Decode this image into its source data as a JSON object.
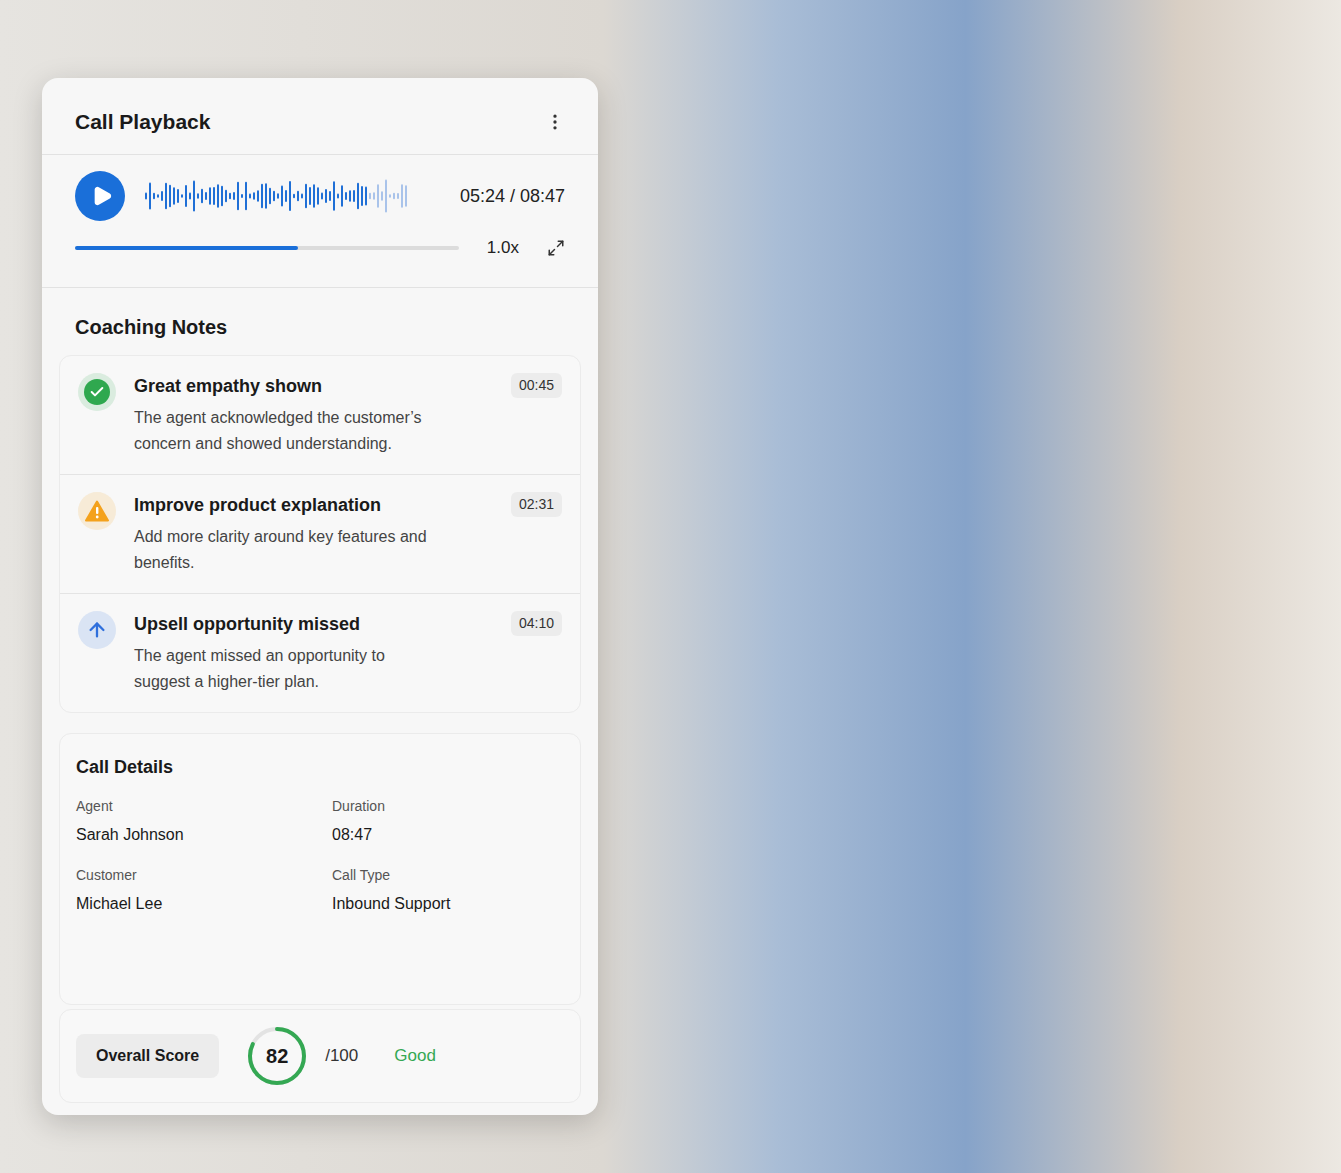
{
  "player": {
    "title": "Call Playback",
    "playing": false,
    "time": "05:24 / 08:47",
    "level": 0.58,
    "speed": "1.0x"
  },
  "coaching_notes": {
    "title": "Coaching Notes",
    "items": [
      {
        "kind": "positive",
        "title": "Great empathy shown",
        "description": "The agent acknowledged the customer’s concern and showed understanding.",
        "time": "00:45",
        "color": "#2fa84f"
      },
      {
        "kind": "warning",
        "title": "Improve product explanation",
        "description": "Add more clarity around key features and benefits.",
        "time": "02:31",
        "color": "#f4a21d"
      },
      {
        "kind": "opportunity",
        "title": "Upsell opportunity missed",
        "description": "The agent missed an opportunity to suggest a higher-tier plan.",
        "time": "04:10",
        "color": "#2f6fdc"
      }
    ]
  },
  "call_details": {
    "title": "Call Details",
    "fields": [
      {
        "label": "Agent",
        "value": "Sarah Johnson"
      },
      {
        "label": "Duration",
        "value": "08:47"
      },
      {
        "label": "Customer",
        "value": "Michael Lee"
      },
      {
        "label": "Call Type",
        "value": "Inbound Support"
      }
    ]
  },
  "score": {
    "label": "Overall Score",
    "value": "82",
    "max": "/100",
    "rating": "Good",
    "level": 0.82
  }
}
